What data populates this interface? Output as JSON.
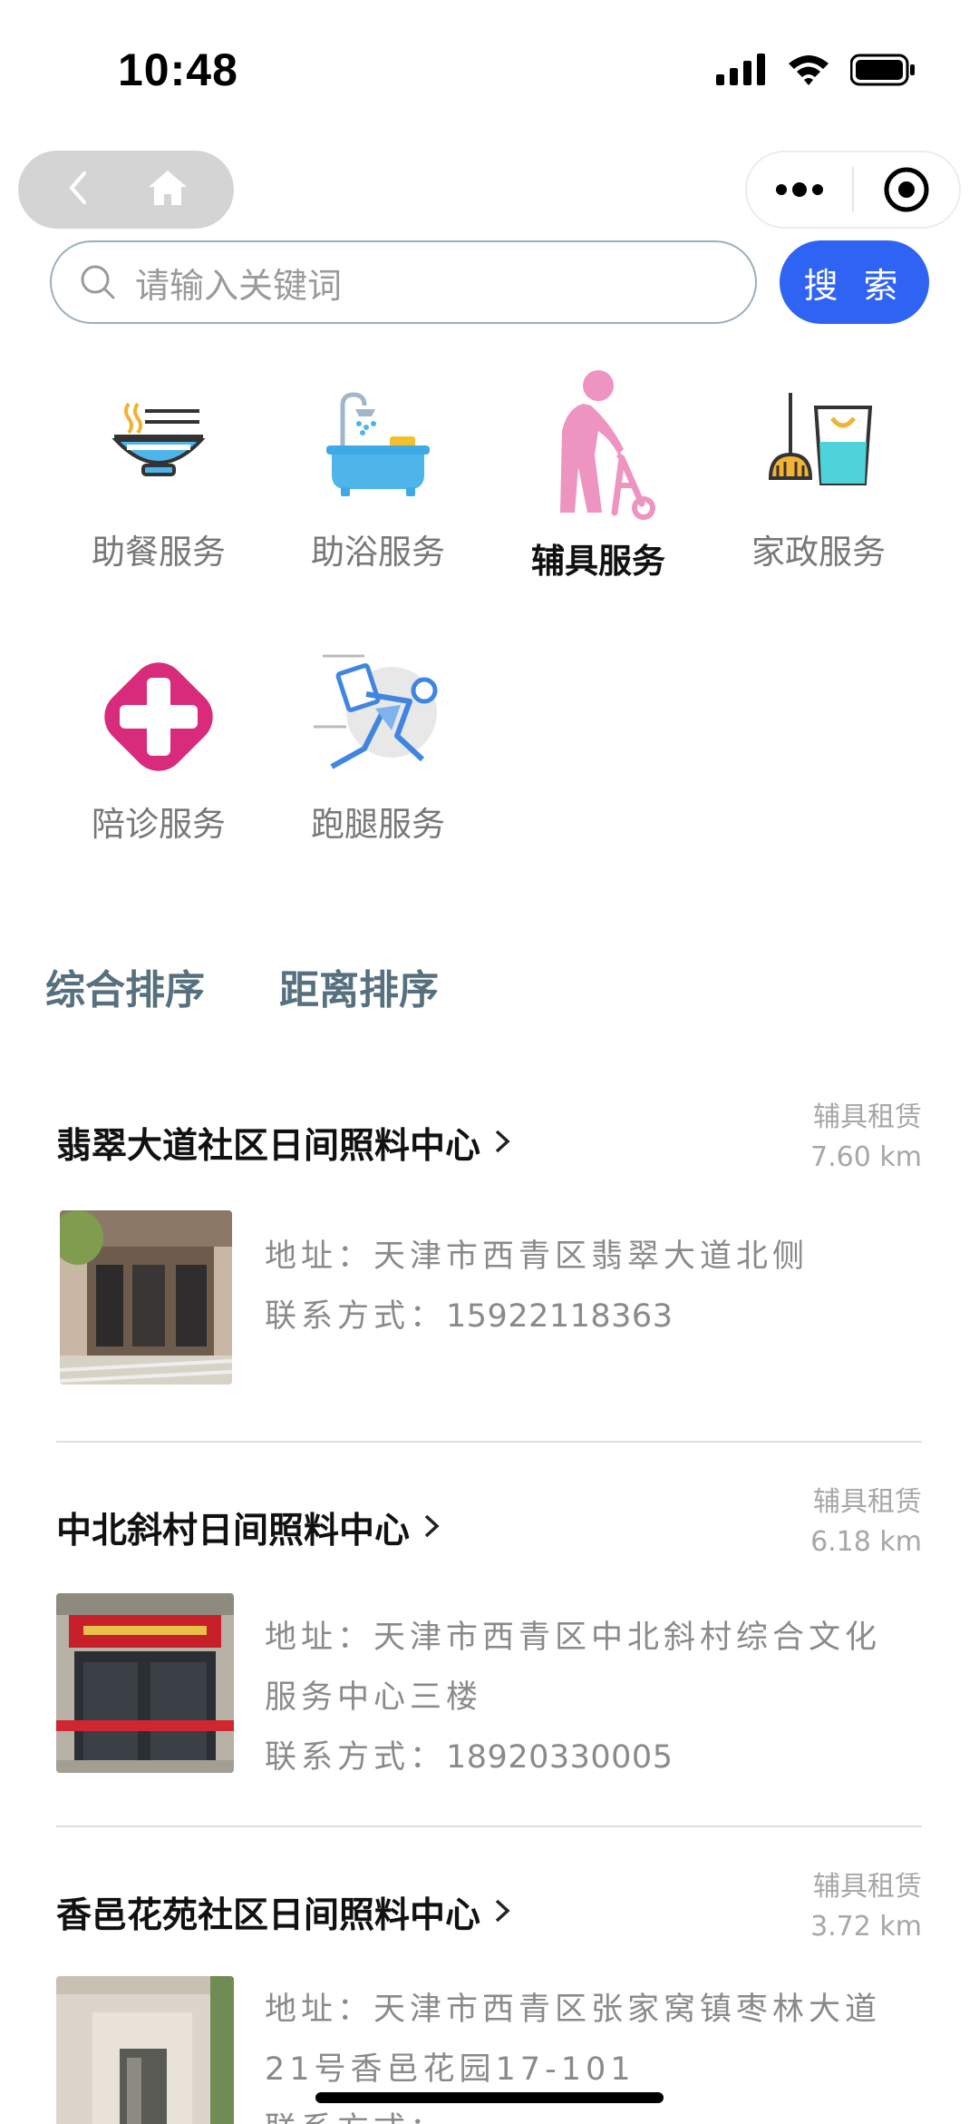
{
  "status_bar": {
    "time": "10:48"
  },
  "search": {
    "placeholder": "请输入关键词",
    "button_label": "搜 索"
  },
  "services": [
    {
      "label": "助餐服务",
      "icon": "meal-bowl-icon"
    },
    {
      "label": "助浴服务",
      "icon": "bathtub-icon"
    },
    {
      "label": "辅具服务",
      "icon": "walker-elder-icon",
      "active": true
    },
    {
      "label": "家政服务",
      "icon": "broom-bucket-icon"
    },
    {
      "label": "陪诊服务",
      "icon": "medical-cross-icon"
    },
    {
      "label": "跑腿服务",
      "icon": "running-courier-icon"
    }
  ],
  "sort_tabs": [
    "综合排序",
    "距离排序"
  ],
  "centers": [
    {
      "name": "翡翠大道社区日间照料中心",
      "tag": "辅具租赁",
      "distance": "7.60 km",
      "address": "地址：天津市西青区翡翠大道北侧",
      "contact_label": "联系方式：",
      "phone": "15922118363"
    },
    {
      "name": "中北斜村日间照料中心",
      "tag": "辅具租赁",
      "distance": "6.18 km",
      "address_line1": "地址：天津市西青区中北斜村综合文化",
      "address_line2": "服务中心三楼",
      "contact_label": "联系方式：",
      "phone": "18920330005"
    },
    {
      "name": "香邑花苑社区日间照料中心",
      "tag": "辅具租赁",
      "distance": "3.72 km",
      "address_line1": "地址：天津市西青区张家窝镇枣林大道",
      "address_line2": "21号香邑花园17-101",
      "contact_label": "联系方式："
    }
  ],
  "colors": {
    "primary": "#2f63f3",
    "sort_text": "#56707e",
    "meta_text": "#a7a7a7",
    "active_service": "#ee94c0"
  }
}
